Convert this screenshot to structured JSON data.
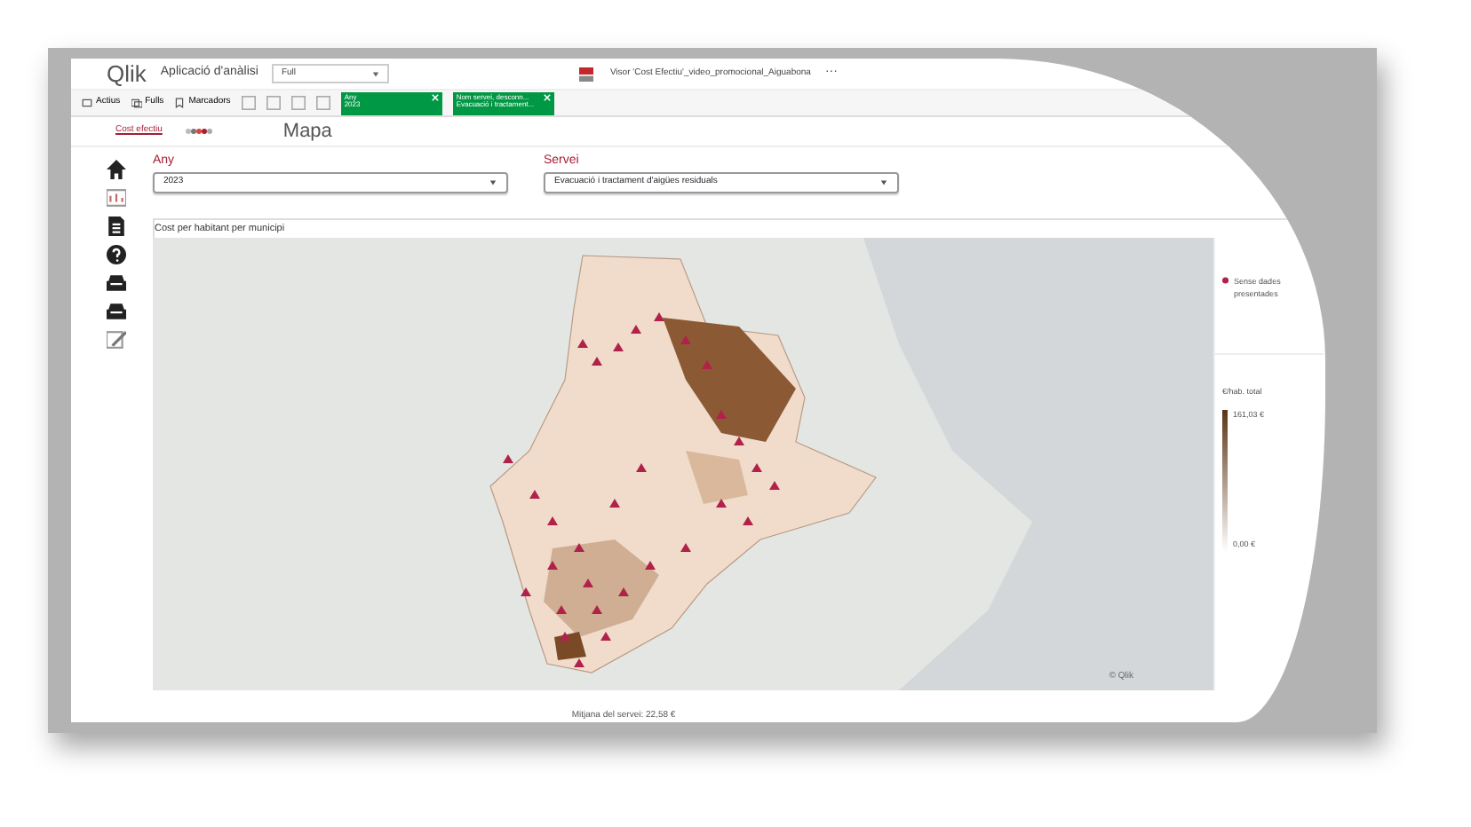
{
  "app": {
    "logo": "Qlik",
    "name": "Aplicació d'anàlisi",
    "sheet_dropdown": "Full",
    "document_title": "Visor 'Cost Efectiu'_video_promocional_Aiguabona",
    "more": "···"
  },
  "toolbar": {
    "buttons": [
      "Actius",
      "Fulls",
      "Marcadors"
    ],
    "selections": [
      {
        "field": "Any",
        "value": "2023"
      },
      {
        "field": "Nom servei, desconn...",
        "value": "Evacuació i tractament..."
      }
    ]
  },
  "sheet": {
    "breadcrumb": "Cost efectiu",
    "title": "Mapa"
  },
  "filters": [
    {
      "label": "Any",
      "value": "2023"
    },
    {
      "label": "Servei",
      "value": "Evacuació i tractament d'aigües residuals"
    }
  ],
  "map": {
    "title": "Cost per habitant per municipi",
    "attribution": "© Qlik",
    "legend": {
      "no_data": "Sense dades presentades",
      "scale_title": "€/hab. total",
      "max": "161,03 €",
      "min": "0,00 €"
    },
    "footer": "Mitjana del servei: 22,58 €"
  }
}
